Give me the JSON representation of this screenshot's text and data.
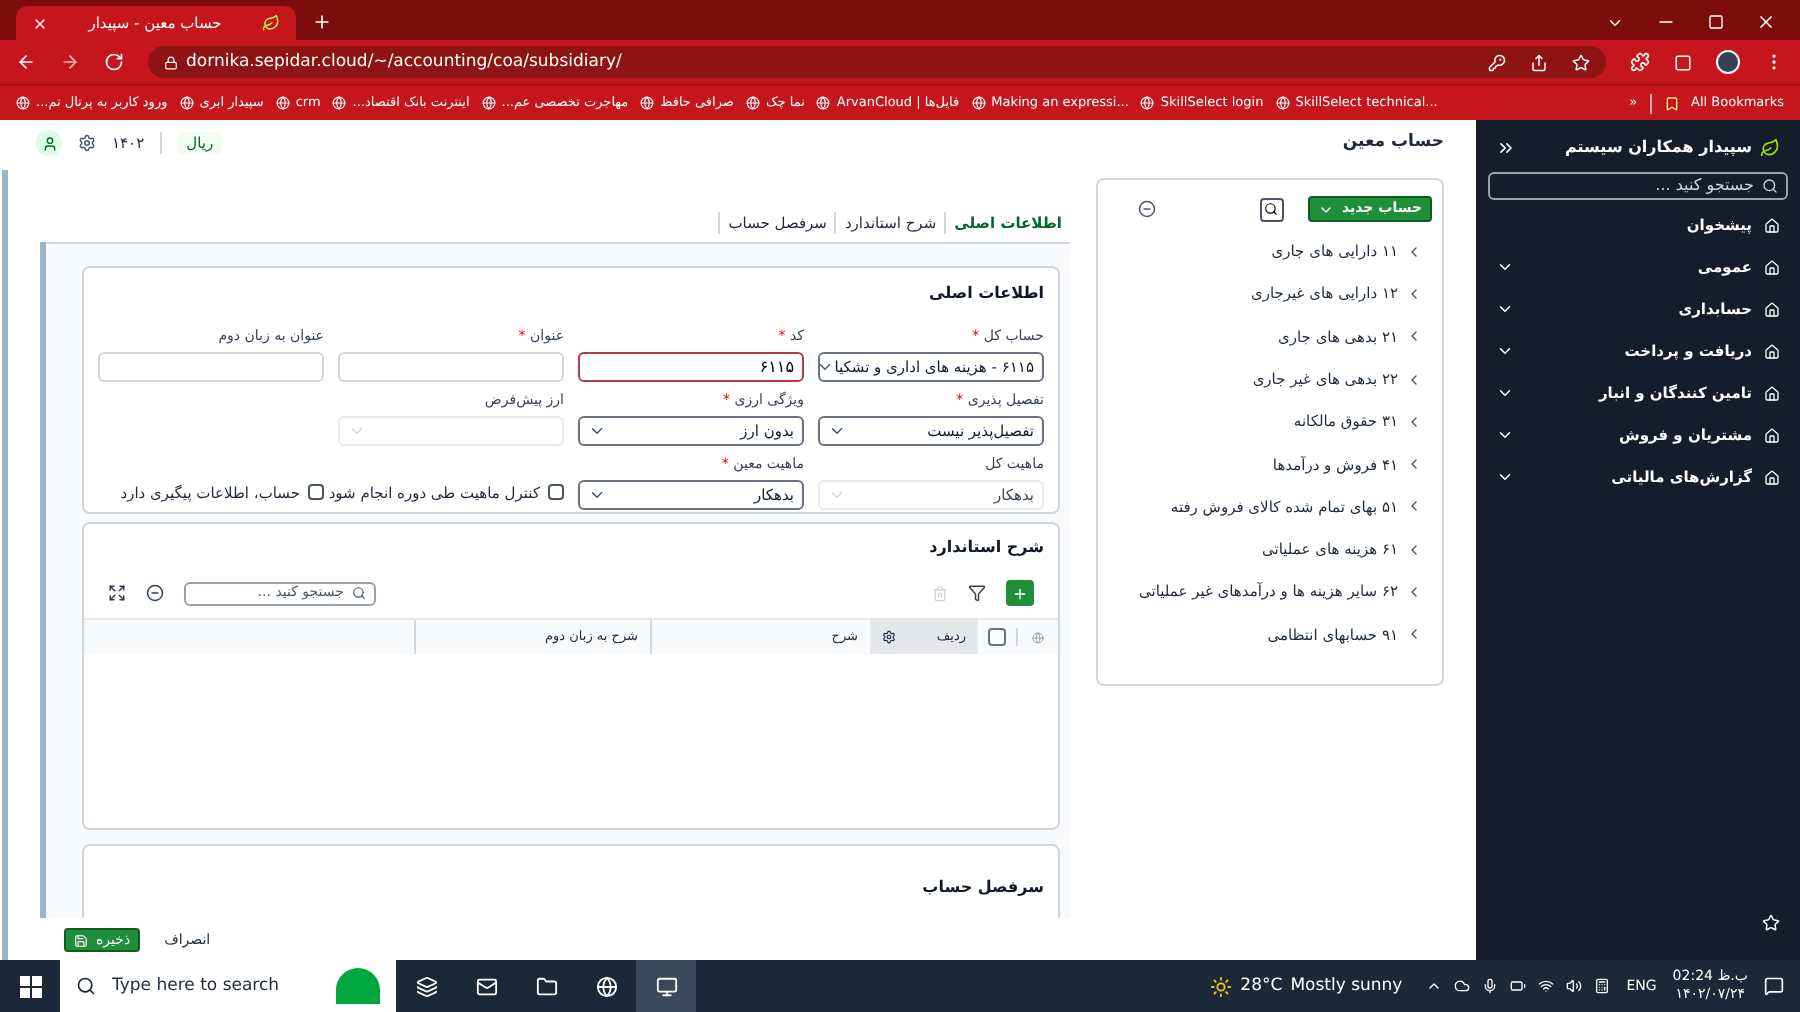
{
  "browser": {
    "tab_title": "حساب معین - سپیدار",
    "url": "dornika.sepidar.cloud/~/accounting/coa/subsidiary/",
    "bookmarks": [
      "SkillSelect technical...",
      "SkillSelect login",
      "Making an expressi...",
      "ArvanCloud | فایل‌ها",
      "نما چک",
      "صرافی حافظ",
      "مهاجرت تخصصی عم...",
      "اینترنت بانک اقتصاد...",
      "crm",
      "سپیدار ابری",
      "ورود کاربر به پرتال تم..."
    ],
    "more": "»",
    "all_bookmarks": "All Bookmarks"
  },
  "header": {
    "currency": "ریال",
    "year": "۱۴۰۲",
    "page_title": "حساب معین"
  },
  "tabs": [
    {
      "label": "اطلاعات اصلی",
      "selected": true
    },
    {
      "label": "شرح استاندارد",
      "selected": false
    },
    {
      "label": "سرفصل حساب",
      "selected": false
    }
  ],
  "main_info": {
    "title": "اطلاعات اصلی",
    "required_mark": "*",
    "fields": [
      {
        "kind": "select",
        "label": "حساب کل",
        "required": true,
        "value": "۶۱۱۵ - هزینه های اداری و تشکیا",
        "disabled": false
      },
      {
        "kind": "input",
        "label": "کد",
        "required": true,
        "value": "۶۱۱۵",
        "invalid": true
      },
      {
        "kind": "input",
        "label": "عنوان",
        "required": true,
        "invalid": false
      },
      {
        "kind": "input",
        "label": "عنوان به زبان دوم",
        "required": false,
        "invalid": false
      },
      {
        "kind": "select",
        "label": "تفصیل پذیری",
        "required": true,
        "value": "تفصیل‌پذیر نیست",
        "disabled": false
      },
      {
        "kind": "select",
        "label": "ویژگی ارزی",
        "required": true,
        "value": "بدون ارز",
        "disabled": false
      },
      {
        "kind": "select",
        "label": "ارز پیش‌فرض",
        "required": false,
        "disabled": true
      },
      {
        "kind": "blank"
      },
      {
        "kind": "select",
        "label": "ماهیت کل",
        "required": false,
        "value": "بدهکار",
        "disabled": true
      },
      {
        "kind": "select",
        "label": "ماهیت معین",
        "required": true,
        "value": "بدهکار",
        "disabled": false
      },
      {
        "kind": "checkbox",
        "label": "کنترل ماهیت طی دوره انجام شود",
        "checked": false
      },
      {
        "kind": "checkbox",
        "label": "حساب، اطلاعات پیگیری دارد",
        "checked": false
      }
    ]
  },
  "standard_desc": {
    "title": "شرح استاندارد",
    "select_all_checked": false,
    "search_placeholder": "جستجو کنید ...",
    "columns": [
      "ردیف",
      "شرح",
      "شرح به زبان دوم"
    ]
  },
  "account_heading": {
    "title": "سرفصل حساب"
  },
  "footer": {
    "save": "ذخیره",
    "cancel": "انصراف"
  },
  "tree": {
    "new_button": "حساب جدید",
    "items": [
      "۱۱ دارایی های جاری",
      "۱۲ دارایی های غیرجاری",
      "۲۱ بدهی های جاری",
      "۲۲ بدهی های غیر جاری",
      "۳۱ حقوق مالکانه",
      "۴۱ فروش و درآمدها",
      "۵۱ بهای تمام شده کالای فروش رفته",
      "۶۱ هزینه های عملیاتی",
      "۶۲ سایر هزینه ها و درآمدهای غیر عملیاتی",
      "۹۱ حسابهای انتظامی"
    ]
  },
  "sidebar": {
    "brand": "سپیدار همکاران سیستم",
    "search_placeholder": "جستجو کنید ...",
    "items": [
      {
        "label": "پیشخوان",
        "kind": "link"
      },
      {
        "label": "عمومی",
        "kind": "group"
      },
      {
        "label": "حسابداری",
        "kind": "group"
      },
      {
        "label": "دریافت و پرداخت",
        "kind": "group"
      },
      {
        "label": "تامین کنندگان و انبار",
        "kind": "group"
      },
      {
        "label": "مشتریان و فروش",
        "kind": "group"
      },
      {
        "label": "گزارش‌های مالیاتی",
        "kind": "group"
      }
    ]
  },
  "taskbar": {
    "search_placeholder": "Type here to search",
    "temperature": "28°C",
    "weather": "Mostly sunny",
    "language": "ENG",
    "time": "02:24 ب.ظ",
    "date": "۱۴۰۲/۰۷/۲۴"
  }
}
